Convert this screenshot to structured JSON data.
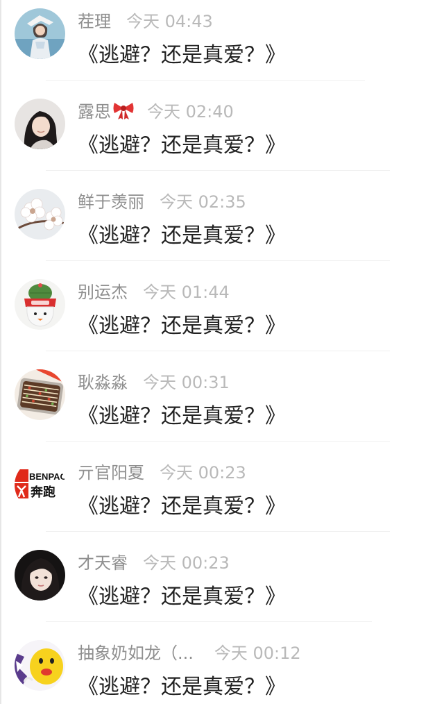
{
  "comments": [
    {
      "name": "茬理",
      "time": "今天 04:43",
      "text": "《逃避？还是真爱？》",
      "avatar": "girl-in-hat-photo-avatar"
    },
    {
      "name": "露思",
      "time": "今天 02:40",
      "text": "《逃避？还是真爱？》",
      "avatar": "girl-portrait-avatar",
      "badge": "ribbon-bow-emoji"
    },
    {
      "name": "鲜于羡丽",
      "time": "今天 02:35",
      "text": "《逃避？还是真爱？》",
      "avatar": "white-flowers-avatar"
    },
    {
      "name": "别运杰",
      "time": "今天 01:44",
      "text": "《逃避？还是真爱？》",
      "avatar": "cactus-pot-avatar"
    },
    {
      "name": "耿淼淼",
      "time": "今天 00:31",
      "text": "《逃避？还是真爱？》",
      "avatar": "food-tray-avatar"
    },
    {
      "name": "亓官阳夏",
      "time": "今天 00:23",
      "text": "《逃避？还是真爱？》",
      "avatar": "benpao-logo-avatar",
      "avatar_text": [
        "BENPAO",
        "奔跑"
      ]
    },
    {
      "name": "才天睿",
      "time": "今天 00:23",
      "text": "《逃避？还是真爱？》",
      "avatar": "girl-face-avatar"
    },
    {
      "name": "抽象奶如龙（...",
      "time": "今天 00:12",
      "text": "《逃避？还是真爱？》",
      "avatar": "yellow-cartoon-avatar"
    }
  ],
  "colors": {
    "name": "#8f8f8f",
    "time": "#b9b9b9",
    "message": "#222222",
    "divider": "#f0f0f0",
    "logo_red": "#e02a1a"
  }
}
